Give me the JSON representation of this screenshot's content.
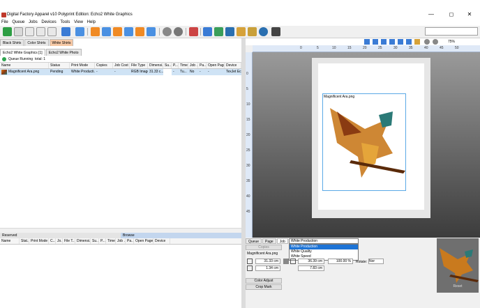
{
  "window": {
    "title": "Digital Factory Apparel v10 Polyprint Edition: Echo2 White Graphics",
    "minimize_glyph": "—",
    "maximize_glyph": "◻",
    "close_glyph": "✕"
  },
  "menu": [
    "File",
    "Queue",
    "Jobs",
    "Devices",
    "Tools",
    "View",
    "Help"
  ],
  "toolbar": {
    "icons": [
      "new-icon",
      "add-job-icon",
      "open-icon",
      "duplicate-icon",
      "delete-icon",
      "print-icon",
      "move-up-icon",
      "move-top-icon",
      "move-down-icon",
      "move-bottom-icon",
      "sort-icon",
      "hold-icon",
      "cancel-icon",
      "color-icon",
      "device-icon",
      "queue-icon",
      "profile-icon",
      "palette-icon",
      "settings-icon",
      "printer-icon"
    ],
    "search_placeholder": ""
  },
  "left": {
    "shirt_tabs": [
      "Black Shirts",
      "Color Shirts",
      "White Shirts"
    ],
    "active_shirt_tab": 2,
    "queue_tabs": [
      "Echo2 White Graphics [1]",
      "Echo2 White Photo"
    ],
    "queue_status": "Queue Running",
    "queue_total": "total: 1",
    "columns": [
      "Name",
      "Status",
      "Print Mode",
      "Copies",
      "Job Cost",
      "File Type",
      "Dimensi...",
      "Su...",
      "P...",
      "Time",
      "Job ...",
      "Pa...",
      "Open Page",
      "Device"
    ],
    "rows": [
      {
        "name": "Magnificent Ara.png",
        "status": "Pending",
        "print_mode": "White Producti...",
        "copies": "-",
        "job_cost": "-",
        "file_type": "RGB Image",
        "dimensions": "31.33 c...",
        "su": "",
        "p": "-",
        "time": "Tu...",
        "job": "No",
        "pa": "-",
        "open_page": "-",
        "device": "TexJet Ec"
      }
    ],
    "bottom_tabs": [
      "Reserved",
      "Browse"
    ],
    "bottom_columns": [
      "Name",
      "Stat...",
      "Print Mode",
      "C...",
      "Jo...",
      "File T...",
      "Dimensi...",
      "Su...",
      "P...",
      "Time",
      "Job ...",
      "Pa...",
      "Open Page",
      "Device"
    ]
  },
  "right": {
    "zoom": "75%",
    "ruler_top": [
      "0",
      "5",
      "10",
      "15",
      "20",
      "25",
      "30",
      "35",
      "40",
      "45",
      "50"
    ],
    "ruler_left": [
      "0",
      "5",
      "10",
      "15",
      "20",
      "25",
      "30",
      "35",
      "40",
      "45"
    ],
    "print_name": "Magnificent Ara.png",
    "panel_tabs": [
      "Queue",
      "Page",
      "Job"
    ],
    "active_panel_tab": 2,
    "copies_label": "Copies",
    "image_name": "Magnificent Ara.png",
    "print_mode_selected": "White Production",
    "print_mode_options": [
      "White Production",
      "White Quality",
      "White Speed"
    ],
    "width": "31.33 cm",
    "height": "36.39 cm",
    "scale": "100.00 %",
    "rotate_label": "Rotate:",
    "rotate_value": "Nor",
    "offset_x": "1.34 cm",
    "offset_y": "7.83 cm",
    "color_adjust": "Color Adjust",
    "crop_mark": "Crop Mark",
    "reset": "Reset"
  }
}
